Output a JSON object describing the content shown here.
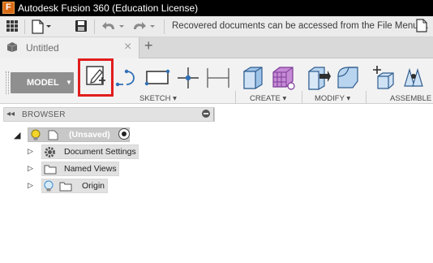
{
  "window": {
    "title": "Autodesk Fusion 360 (Education License)",
    "logo_letter": "F"
  },
  "quick_access": {
    "icons": [
      "grid-menu-icon",
      "file-dropdown-icon",
      "save-icon",
      "undo-icon",
      "redo-icon"
    ],
    "notice": "Recovered documents can be accessed from the File Menu ..."
  },
  "tabs": {
    "active_label": "Untitled",
    "close_glyph": "×",
    "add_glyph": "+"
  },
  "ribbon": {
    "workspace": "MODEL",
    "workspace_caret": "▼",
    "groups": [
      {
        "label": "SKETCH ▾",
        "tools": [
          "create-sketch-icon",
          "arc-icon",
          "rectangle-icon",
          "point-icon",
          "sketch-dimension-icon"
        ]
      },
      {
        "label": "CREATE ▾",
        "tools": [
          "extrude-icon",
          "form-icon"
        ]
      },
      {
        "label": "MODIFY ▾",
        "tools": [
          "press-pull-icon",
          "fillet-icon"
        ]
      },
      {
        "label": "ASSEMBLE ▾",
        "tools": [
          "new-component-icon",
          "joint-icon"
        ]
      }
    ],
    "highlight_color": "#e11d1d"
  },
  "browser": {
    "collapse_glyph": "◂◂",
    "title": "BROWSER",
    "root": {
      "label": "(Unsaved)",
      "expander": "◢"
    },
    "children": [
      {
        "label": "Document Settings",
        "expander": "▷",
        "icon": "gear-icon"
      },
      {
        "label": "Named Views",
        "expander": "▷",
        "icon": "folder-icon"
      },
      {
        "label": "Origin",
        "expander": "▷",
        "icon": "folder-icon",
        "light": "lightbulb-icon"
      }
    ]
  },
  "colors": {
    "titlebar": "#000000",
    "logo": "#d76a17",
    "workspace_button": "#8f8f8f",
    "icon_blue": "#2f6fb5",
    "icon_purple": "#7d3a96"
  }
}
